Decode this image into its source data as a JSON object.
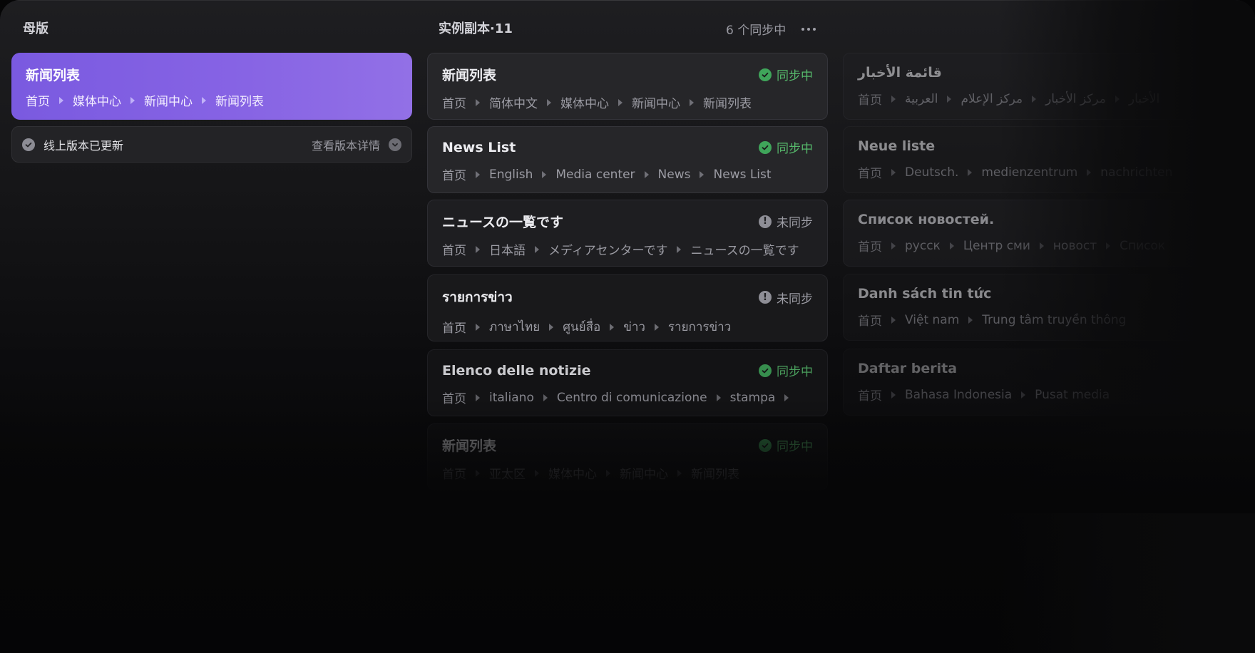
{
  "left_title": "母版",
  "master": {
    "title": "新闻列表",
    "crumbs": [
      "首页",
      "媒体中心",
      "新闻中心",
      "新闻列表"
    ]
  },
  "status_bar": {
    "text": "线上版本已更新",
    "link": "查看版本详情"
  },
  "copies_title": "实例副本·11",
  "sync_count": "6 个同步中",
  "status_labels": {
    "synced": "同步中",
    "unsynced": "未同步"
  },
  "col2": [
    {
      "title": "新闻列表",
      "status": "synced",
      "crumbs": [
        "首页",
        "简体中文",
        "媒体中心",
        "新闻中心",
        "新闻列表"
      ]
    },
    {
      "title": "News List",
      "status": "synced",
      "crumbs": [
        "首页",
        "English",
        "Media center",
        "News",
        "News List"
      ]
    },
    {
      "title": "ニュースの一覧です",
      "status": "unsynced",
      "crumbs": [
        "首页",
        "日本語",
        "メディアセンターです",
        "ニュースの一覧です"
      ]
    },
    {
      "title": "รายการข่าว",
      "status": "unsynced",
      "crumbs": [
        "首页",
        "ภาษาไทย",
        "ศูนย์สื่อ",
        "ข่าว",
        "รายการข่าว"
      ]
    },
    {
      "title": "Elenco delle notizie",
      "status": "synced",
      "crumbs": [
        "首页",
        "italiano",
        "Centro di comunicazione",
        "stampa"
      ]
    },
    {
      "title": "新闻列表",
      "status": "synced",
      "crumbs": [
        "首页",
        "亚太区",
        "媒体中心",
        "新闻中心",
        "新闻列表"
      ]
    }
  ],
  "col3": [
    {
      "title": "قائمة الأخبار",
      "crumbs": [
        "首页",
        "العربية",
        "مركز الإعلام",
        "مركز الأخبار",
        "الأخبار"
      ]
    },
    {
      "title": "Neue liste",
      "crumbs": [
        "首页",
        "Deutsch.",
        "medienzentrum",
        "nachrichten"
      ]
    },
    {
      "title": "Список новостей.",
      "crumbs": [
        "首页",
        "русск",
        "Центр сми",
        "новост",
        "Список"
      ]
    },
    {
      "title": "Danh sách tin tức",
      "crumbs": [
        "首页",
        "Việt nam",
        "Trung tâm truyền thông"
      ]
    },
    {
      "title": "Daftar berita",
      "crumbs": [
        "首页",
        "Bahasa Indonesia",
        "Pusat media"
      ]
    }
  ]
}
